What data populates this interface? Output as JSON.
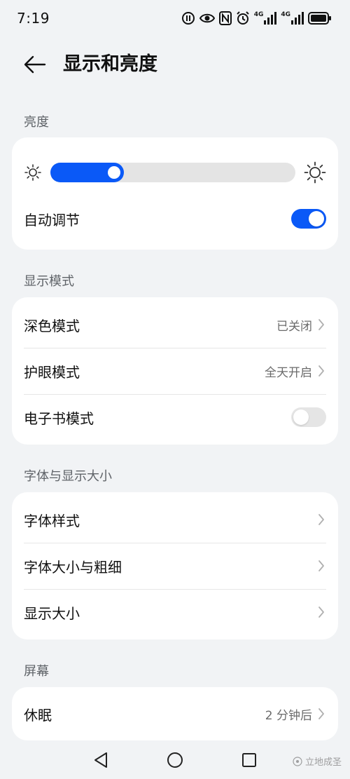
{
  "status_bar": {
    "time": "7:19",
    "net_label_1": "4G",
    "net_label_2": "4G"
  },
  "header": {
    "title": "显示和亮度"
  },
  "brightness_section": {
    "label": "亮度",
    "level": 0.3,
    "auto_adjust_label": "自动调节",
    "auto_adjust_on": true
  },
  "display_mode_section": {
    "label": "显示模式",
    "dark_mode": {
      "label": "深色模式",
      "value": "已关闭"
    },
    "eye_comfort": {
      "label": "护眼模式",
      "value": "全天开启"
    },
    "ebook_mode": {
      "label": "电子书模式",
      "on": false
    }
  },
  "font_section": {
    "label": "字体与显示大小",
    "items": [
      {
        "label": "字体样式"
      },
      {
        "label": "字体大小与粗细"
      },
      {
        "label": "显示大小"
      }
    ]
  },
  "screen_section": {
    "label": "屏幕",
    "sleep": {
      "label": "休眠",
      "value": "2 分钟后"
    }
  },
  "watermark": {
    "text": "立地成圣"
  },
  "colors": {
    "accent": "#0a59f7",
    "background": "#f1f3f5",
    "card": "#ffffff"
  }
}
